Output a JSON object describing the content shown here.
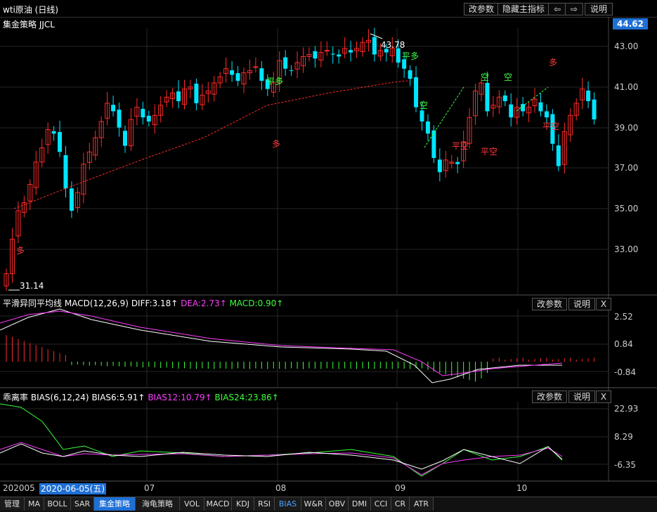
{
  "window": {
    "title": "wti原油 (日线)",
    "buttons": {
      "params": "改参数",
      "hide_main": "隐藏主指标",
      "left": "⇦",
      "right": "⇨",
      "help": "说明"
    }
  },
  "main_panel": {
    "strategy_label": "集金策略 JJCL",
    "current_price": "44.62",
    "y_ticks": [
      "43.00",
      "41.00",
      "39.00",
      "37.00",
      "35.00",
      "33.00"
    ],
    "high_label": "43.78",
    "low_label": "31.14",
    "signals": [
      {
        "text": "多",
        "color": "#ff3a3a"
      },
      {
        "text": "平多",
        "color": "#3cff3c"
      },
      {
        "text": "多",
        "color": "#ff3a3a"
      },
      {
        "text": "平多",
        "color": "#3cff3c"
      },
      {
        "text": "空",
        "color": "#3cff3c"
      },
      {
        "text": "平空",
        "color": "#ff3a3a"
      },
      {
        "text": "空",
        "color": "#3cff3c"
      },
      {
        "text": "平空",
        "color": "#ff3a3a"
      },
      {
        "text": "空",
        "color": "#3cff3c"
      },
      {
        "text": "多",
        "color": "#ff3a3a"
      },
      {
        "text": "平空",
        "color": "#ff3a3a"
      }
    ]
  },
  "macd_panel": {
    "name": "平滑异同平均线",
    "params": "MACD(12,26,9)",
    "diff": "DIFF:3.18↑",
    "dea": "DEA:2.73↑",
    "macd": "MACD:0.90↑",
    "y_ticks": [
      "2.52",
      "0.84",
      "-0.84"
    ],
    "buttons": {
      "params": "改参数",
      "help": "说明",
      "close": "X"
    }
  },
  "bias_panel": {
    "name": "乖离率",
    "params": "BIAS(6,12,24)",
    "bias6": "BIAS6:5.91↑",
    "bias12": "BIAS12:10.79↑",
    "bias24": "BIAS24:23.86↑",
    "y_ticks": [
      "22.93",
      "8.29",
      "-6.35"
    ],
    "buttons": {
      "params": "改参数",
      "help": "说明",
      "close": "X"
    }
  },
  "x_axis": {
    "start": "202005",
    "selected_date": "2020-06-05(五)",
    "months": [
      "07",
      "08",
      "09",
      "10"
    ]
  },
  "tabs": [
    "管理",
    "MA",
    "BOLL",
    "SAR",
    "集金策略",
    "海龟策略",
    "VOL",
    "MACD",
    "KDJ",
    "RSI",
    "BIAS",
    "W&R",
    "OBV",
    "DMI",
    "CCI",
    "CR",
    "ATR"
  ],
  "active_tab": "集金策略",
  "active_indicator_tab": "BIAS",
  "colors": {
    "up": "#ff2a2a",
    "down": "#00e5ff",
    "accent": "#1e6fd6",
    "bg": "#000000"
  }
}
